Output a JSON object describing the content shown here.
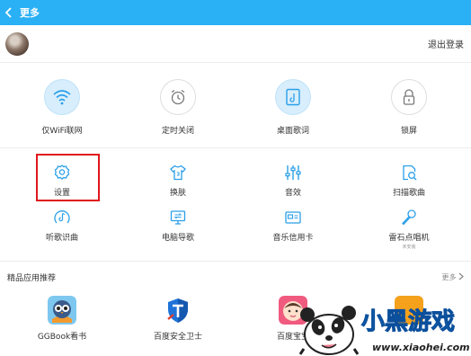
{
  "header": {
    "title": "更多"
  },
  "user": {
    "logout_label": "退出登录"
  },
  "top_items": [
    {
      "label": "仅WiFi联网",
      "icon": "wifi-icon"
    },
    {
      "label": "定时关闭",
      "icon": "alarm-clock-icon"
    },
    {
      "label": "桌面歌词",
      "icon": "desktop-lyrics-icon"
    },
    {
      "label": "锁屏",
      "icon": "lock-icon"
    }
  ],
  "grid_items": [
    {
      "label": "设置",
      "icon": "gear-icon"
    },
    {
      "label": "换肤",
      "icon": "tshirt-icon"
    },
    {
      "label": "音效",
      "icon": "equalizer-icon"
    },
    {
      "label": "扫描歌曲",
      "icon": "scan-music-icon"
    },
    {
      "label": "听歌识曲",
      "icon": "song-recognition-icon"
    },
    {
      "label": "电脑导歌",
      "icon": "pc-transfer-icon"
    },
    {
      "label": "音乐信用卡",
      "icon": "credit-card-icon"
    },
    {
      "label": "雷石点唱机",
      "sub": "未安装",
      "icon": "microphone-icon"
    }
  ],
  "recommend": {
    "title": "精品应用推荐",
    "more_label": "更多",
    "apps": [
      {
        "label": "GGBook看书",
        "icon": "ggbook-owl-icon"
      },
      {
        "label": "百度安全卫士",
        "icon": "baidu-security-shield-icon"
      },
      {
        "label": "百度宝宝",
        "icon": "baby-face-icon"
      },
      {
        "label": "",
        "icon": "orange-app-icon"
      }
    ]
  },
  "watermark": {
    "text_main": "小黑游戏",
    "text_url": "www.xiaohei.com"
  },
  "colors": {
    "accent": "#2ab0f5",
    "highlight": "#e0161c",
    "icon_blue": "#2a9fe8"
  }
}
